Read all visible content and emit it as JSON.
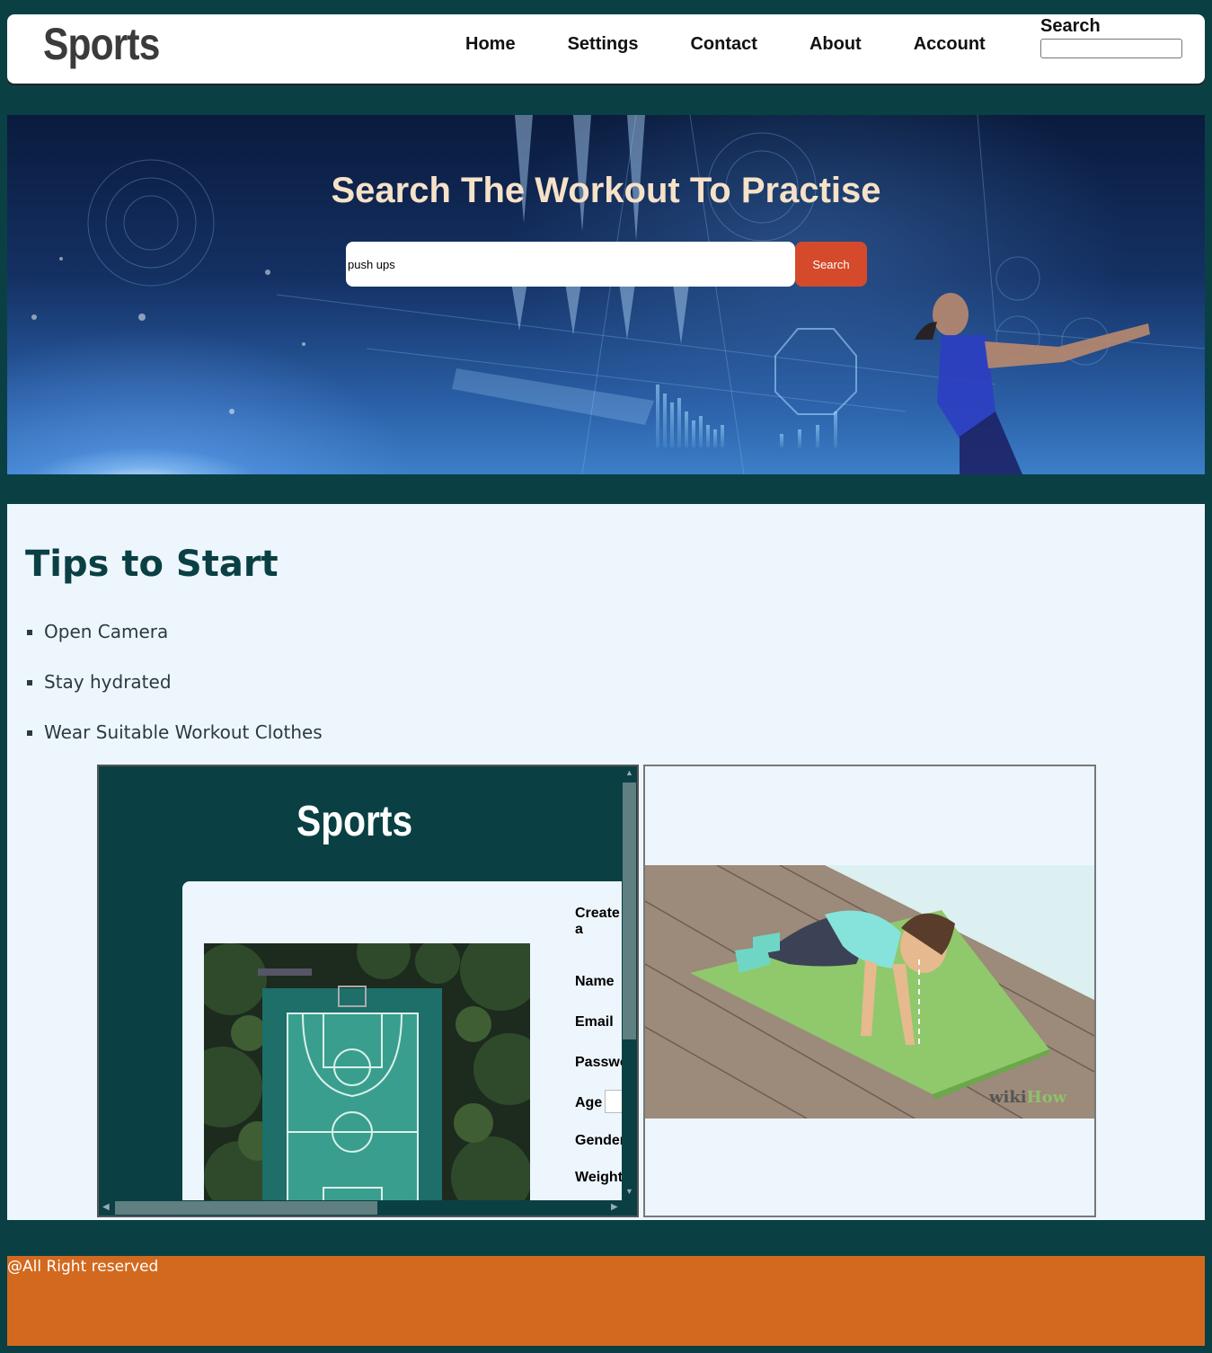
{
  "header": {
    "logo": "Sports",
    "nav": [
      "Home",
      "Settings",
      "Contact",
      "About",
      "Account"
    ],
    "search_label": "Search",
    "search_value": ""
  },
  "hero": {
    "title": "Search The Workout To Practise",
    "search_value": "push ups",
    "search_button": "Search"
  },
  "tips": {
    "title": "Tips to Start",
    "items": [
      "Open Camera",
      "Stay hydrated",
      "Wear Suitable Workout Clothes"
    ]
  },
  "embed_left": {
    "logo": "Sports",
    "create_heading": "Create a",
    "fields": [
      "Name",
      "Email",
      "Passwo",
      "Age",
      "Gender",
      "Weight"
    ]
  },
  "embed_right": {
    "watermark_wiki": "wiki",
    "watermark_how": "How"
  },
  "footer": {
    "text": "@All Right reserved"
  },
  "colors": {
    "page_bg": "#0a4044",
    "section_bg": "#eef6fd",
    "accent_button": "#d44a2b",
    "footer_bg": "#d2691e",
    "hero_title": "#f6e2c8"
  }
}
